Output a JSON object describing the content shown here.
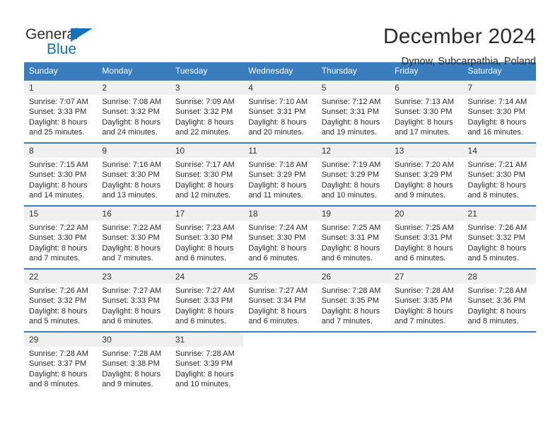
{
  "brand": {
    "name_top": "General",
    "name_bottom": "Blue",
    "accent_color": "#1272b8"
  },
  "header": {
    "title": "December 2024",
    "subtitle": "Dynow, Subcarpathia, Poland"
  },
  "calendar": {
    "header_bg": "#3a7dbf",
    "daynum_bg": "#f0f0f0",
    "weekdays": [
      "Sunday",
      "Monday",
      "Tuesday",
      "Wednesday",
      "Thursday",
      "Friday",
      "Saturday"
    ],
    "weeks": [
      [
        {
          "day": "1",
          "sunrise": "Sunrise: 7:07 AM",
          "sunset": "Sunset: 3:33 PM",
          "daylight1": "Daylight: 8 hours",
          "daylight2": "and 25 minutes."
        },
        {
          "day": "2",
          "sunrise": "Sunrise: 7:08 AM",
          "sunset": "Sunset: 3:32 PM",
          "daylight1": "Daylight: 8 hours",
          "daylight2": "and 24 minutes."
        },
        {
          "day": "3",
          "sunrise": "Sunrise: 7:09 AM",
          "sunset": "Sunset: 3:32 PM",
          "daylight1": "Daylight: 8 hours",
          "daylight2": "and 22 minutes."
        },
        {
          "day": "4",
          "sunrise": "Sunrise: 7:10 AM",
          "sunset": "Sunset: 3:31 PM",
          "daylight1": "Daylight: 8 hours",
          "daylight2": "and 20 minutes."
        },
        {
          "day": "5",
          "sunrise": "Sunrise: 7:12 AM",
          "sunset": "Sunset: 3:31 PM",
          "daylight1": "Daylight: 8 hours",
          "daylight2": "and 19 minutes."
        },
        {
          "day": "6",
          "sunrise": "Sunrise: 7:13 AM",
          "sunset": "Sunset: 3:30 PM",
          "daylight1": "Daylight: 8 hours",
          "daylight2": "and 17 minutes."
        },
        {
          "day": "7",
          "sunrise": "Sunrise: 7:14 AM",
          "sunset": "Sunset: 3:30 PM",
          "daylight1": "Daylight: 8 hours",
          "daylight2": "and 16 minutes."
        }
      ],
      [
        {
          "day": "8",
          "sunrise": "Sunrise: 7:15 AM",
          "sunset": "Sunset: 3:30 PM",
          "daylight1": "Daylight: 8 hours",
          "daylight2": "and 14 minutes."
        },
        {
          "day": "9",
          "sunrise": "Sunrise: 7:16 AM",
          "sunset": "Sunset: 3:30 PM",
          "daylight1": "Daylight: 8 hours",
          "daylight2": "and 13 minutes."
        },
        {
          "day": "10",
          "sunrise": "Sunrise: 7:17 AM",
          "sunset": "Sunset: 3:30 PM",
          "daylight1": "Daylight: 8 hours",
          "daylight2": "and 12 minutes."
        },
        {
          "day": "11",
          "sunrise": "Sunrise: 7:18 AM",
          "sunset": "Sunset: 3:29 PM",
          "daylight1": "Daylight: 8 hours",
          "daylight2": "and 11 minutes."
        },
        {
          "day": "12",
          "sunrise": "Sunrise: 7:19 AM",
          "sunset": "Sunset: 3:29 PM",
          "daylight1": "Daylight: 8 hours",
          "daylight2": "and 10 minutes."
        },
        {
          "day": "13",
          "sunrise": "Sunrise: 7:20 AM",
          "sunset": "Sunset: 3:29 PM",
          "daylight1": "Daylight: 8 hours",
          "daylight2": "and 9 minutes."
        },
        {
          "day": "14",
          "sunrise": "Sunrise: 7:21 AM",
          "sunset": "Sunset: 3:30 PM",
          "daylight1": "Daylight: 8 hours",
          "daylight2": "and 8 minutes."
        }
      ],
      [
        {
          "day": "15",
          "sunrise": "Sunrise: 7:22 AM",
          "sunset": "Sunset: 3:30 PM",
          "daylight1": "Daylight: 8 hours",
          "daylight2": "and 7 minutes."
        },
        {
          "day": "16",
          "sunrise": "Sunrise: 7:22 AM",
          "sunset": "Sunset: 3:30 PM",
          "daylight1": "Daylight: 8 hours",
          "daylight2": "and 7 minutes."
        },
        {
          "day": "17",
          "sunrise": "Sunrise: 7:23 AM",
          "sunset": "Sunset: 3:30 PM",
          "daylight1": "Daylight: 8 hours",
          "daylight2": "and 6 minutes."
        },
        {
          "day": "18",
          "sunrise": "Sunrise: 7:24 AM",
          "sunset": "Sunset: 3:30 PM",
          "daylight1": "Daylight: 8 hours",
          "daylight2": "and 6 minutes."
        },
        {
          "day": "19",
          "sunrise": "Sunrise: 7:25 AM",
          "sunset": "Sunset: 3:31 PM",
          "daylight1": "Daylight: 8 hours",
          "daylight2": "and 6 minutes."
        },
        {
          "day": "20",
          "sunrise": "Sunrise: 7:25 AM",
          "sunset": "Sunset: 3:31 PM",
          "daylight1": "Daylight: 8 hours",
          "daylight2": "and 6 minutes."
        },
        {
          "day": "21",
          "sunrise": "Sunrise: 7:26 AM",
          "sunset": "Sunset: 3:32 PM",
          "daylight1": "Daylight: 8 hours",
          "daylight2": "and 5 minutes."
        }
      ],
      [
        {
          "day": "22",
          "sunrise": "Sunrise: 7:26 AM",
          "sunset": "Sunset: 3:32 PM",
          "daylight1": "Daylight: 8 hours",
          "daylight2": "and 5 minutes."
        },
        {
          "day": "23",
          "sunrise": "Sunrise: 7:27 AM",
          "sunset": "Sunset: 3:33 PM",
          "daylight1": "Daylight: 8 hours",
          "daylight2": "and 6 minutes."
        },
        {
          "day": "24",
          "sunrise": "Sunrise: 7:27 AM",
          "sunset": "Sunset: 3:33 PM",
          "daylight1": "Daylight: 8 hours",
          "daylight2": "and 6 minutes."
        },
        {
          "day": "25",
          "sunrise": "Sunrise: 7:27 AM",
          "sunset": "Sunset: 3:34 PM",
          "daylight1": "Daylight: 8 hours",
          "daylight2": "and 6 minutes."
        },
        {
          "day": "26",
          "sunrise": "Sunrise: 7:28 AM",
          "sunset": "Sunset: 3:35 PM",
          "daylight1": "Daylight: 8 hours",
          "daylight2": "and 7 minutes."
        },
        {
          "day": "27",
          "sunrise": "Sunrise: 7:28 AM",
          "sunset": "Sunset: 3:35 PM",
          "daylight1": "Daylight: 8 hours",
          "daylight2": "and 7 minutes."
        },
        {
          "day": "28",
          "sunrise": "Sunrise: 7:28 AM",
          "sunset": "Sunset: 3:36 PM",
          "daylight1": "Daylight: 8 hours",
          "daylight2": "and 8 minutes."
        }
      ],
      [
        {
          "day": "29",
          "sunrise": "Sunrise: 7:28 AM",
          "sunset": "Sunset: 3:37 PM",
          "daylight1": "Daylight: 8 hours",
          "daylight2": "and 8 minutes."
        },
        {
          "day": "30",
          "sunrise": "Sunrise: 7:28 AM",
          "sunset": "Sunset: 3:38 PM",
          "daylight1": "Daylight: 8 hours",
          "daylight2": "and 9 minutes."
        },
        {
          "day": "31",
          "sunrise": "Sunrise: 7:28 AM",
          "sunset": "Sunset: 3:39 PM",
          "daylight1": "Daylight: 8 hours",
          "daylight2": "and 10 minutes."
        },
        {
          "day": "",
          "sunrise": "",
          "sunset": "",
          "daylight1": "",
          "daylight2": ""
        },
        {
          "day": "",
          "sunrise": "",
          "sunset": "",
          "daylight1": "",
          "daylight2": ""
        },
        {
          "day": "",
          "sunrise": "",
          "sunset": "",
          "daylight1": "",
          "daylight2": ""
        },
        {
          "day": "",
          "sunrise": "",
          "sunset": "",
          "daylight1": "",
          "daylight2": ""
        }
      ]
    ]
  }
}
